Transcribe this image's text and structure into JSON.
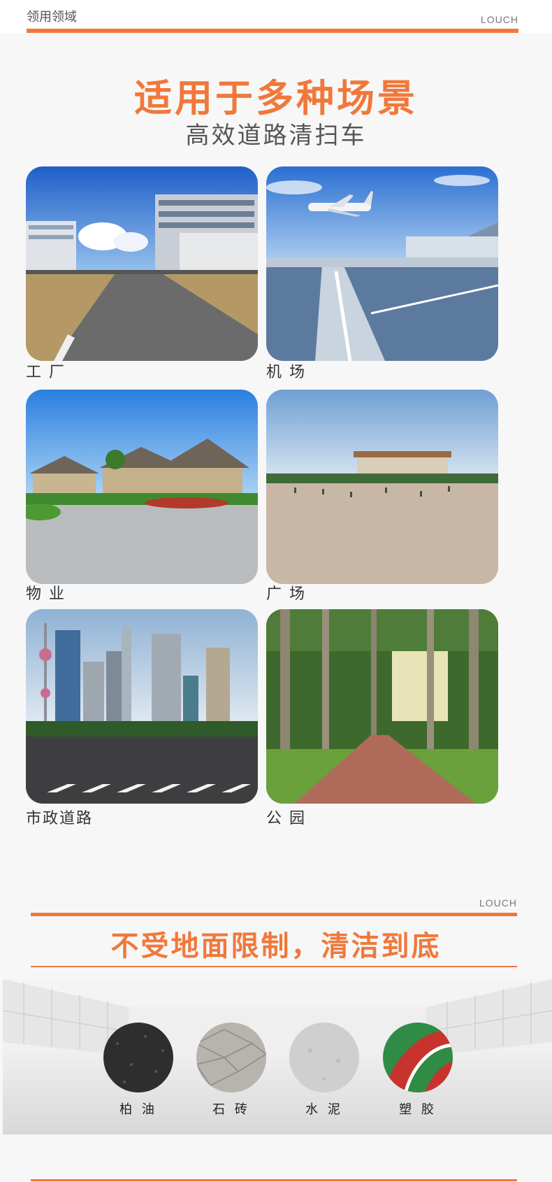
{
  "header": {
    "section_label": "领用领域",
    "brand": "LOUCH"
  },
  "hero": {
    "title": "适用于多种场景",
    "subtitle": "高效道路清扫车"
  },
  "scenes": [
    {
      "label": "工 厂",
      "icon": "factory-road-image"
    },
    {
      "label": "机 场",
      "icon": "airport-runway-image"
    },
    {
      "label": "物 业",
      "icon": "property-houses-image"
    },
    {
      "label": "广 场",
      "icon": "public-square-image"
    },
    {
      "label": "市政道路",
      "icon": "city-road-image"
    },
    {
      "label": "公 园",
      "icon": "park-path-image"
    }
  ],
  "surfaces_section": {
    "brand": "LOUCH",
    "title": "不受地面限制，清洁到底",
    "items": [
      {
        "label": "柏 油",
        "icon": "asphalt-swatch"
      },
      {
        "label": "石 砖",
        "icon": "stone-brick-swatch"
      },
      {
        "label": "水 泥",
        "icon": "cement-swatch"
      },
      {
        "label": "塑 胶",
        "icon": "rubber-track-swatch"
      }
    ]
  },
  "colors": {
    "accent": "#f0783a",
    "background": "#f7f7f7"
  }
}
